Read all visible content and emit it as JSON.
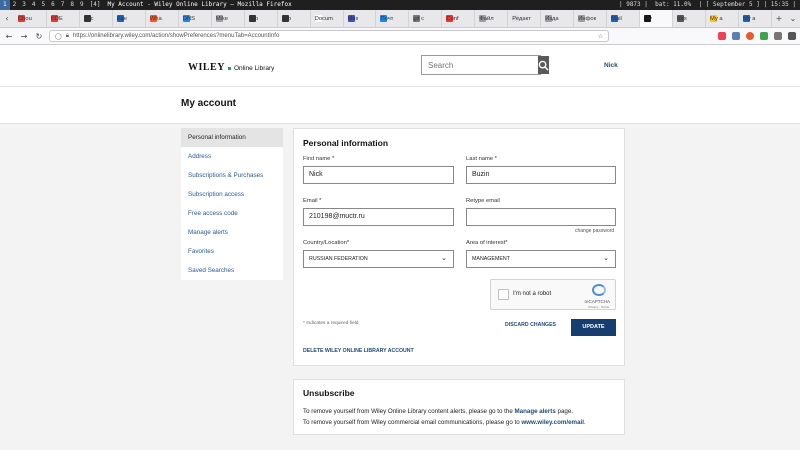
{
  "wm": {
    "workspaces": [
      "1",
      "2",
      "3",
      "4",
      "5",
      "6",
      "7",
      "8",
      "9",
      "[4]"
    ],
    "title": "My Account - Wiley Online Library — Mozilla Firefox",
    "status": "| 9873 |  bat: 11.0%  | [ September 5 ] | 15:35 |"
  },
  "tabs": [
    {
      "label": "Chou",
      "color": "#e53935"
    },
    {
      "label": "KDE",
      "color": "#e53935"
    },
    {
      "label": "Acc",
      "color": "#333333"
    },
    {
      "label": "Кан",
      "color": "#1565c0"
    },
    {
      "label": "Wha",
      "color": "#ff5722"
    },
    {
      "label": "DNS",
      "color": "#1e88e5"
    },
    {
      "label": "Mike",
      "color": "#9e9e9e"
    },
    {
      "label": "cpp",
      "color": "#333333"
    },
    {
      "label": "cpp",
      "color": "#333333"
    },
    {
      "label": "Docum",
      "color": "#ffffff"
    },
    {
      "label": "Mes",
      "color": "#3f51b5"
    },
    {
      "label": "Почт",
      "color": "#1e88e5"
    },
    {
      "label": "git c",
      "color": "#777777"
    },
    {
      "label": "Conf",
      "color": "#e53935"
    },
    {
      "label": "Файл",
      "color": "#9e9e9e"
    },
    {
      "label": "Редакт",
      "color": "#e0e0e0"
    },
    {
      "label": "Изда",
      "color": "#9e9e9e"
    },
    {
      "label": "Инфок",
      "color": "#9e9e9e"
    },
    {
      "label": "Mail",
      "color": "#1565c0"
    },
    {
      "label": "My",
      "color": "#111111"
    },
    {
      "label": "tors",
      "color": "#555555"
    },
    {
      "label": "My a",
      "color": "#fbc02d"
    },
    {
      "label": "My a",
      "color": "#1565c0"
    }
  ],
  "nav": {
    "url": "https://onlinelibrary.wiley.com/action/showPreferences?menuTab=AccountInfo"
  },
  "site": {
    "logo_main": "WILEY",
    "logo_sub": "Online Library",
    "search_placeholder": "Search",
    "user": "Nick"
  },
  "page_title": "My account",
  "sidenav": [
    "Personal information",
    "Address",
    "Subscriptions & Purchases",
    "Subscription access",
    "Free access code",
    "Manage alerts",
    "Favorites",
    "Saved Searches"
  ],
  "form": {
    "heading": "Personal information",
    "first_name_label": "First name *",
    "first_name_value": "Nick",
    "last_name_label": "Last name *",
    "last_name_value": "Buzin",
    "email_label": "Email *",
    "email_value": "210198@muctr.ru",
    "retype_label": "Retype email",
    "retype_value": "",
    "change_password": "change password",
    "country_label": "Country/Location*",
    "country_value": "RUSSIAN FEDERATION",
    "interest_label": "Area of interest*",
    "interest_value": "MANAGEMENT",
    "captcha_text": "I'm not a robot",
    "captcha_brand": "reCAPTCHA",
    "captcha_links": "Privacy - Terms",
    "required_note": "* Indicates a required field",
    "discard": "DISCARD CHANGES",
    "update": "UPDATE",
    "delete": "DELETE WILEY ONLINE LIBRARY ACCOUNT"
  },
  "unsub": {
    "heading": "Unsubscribe",
    "line1_pre": "To remove yourself from Wiley Online Library content alerts, please go to the ",
    "line1_link": "Manage alerts",
    "line1_post": " page.",
    "line2_pre": "To remove yourself from Wiley commercial email communications, please go to ",
    "line2_link": "www.wiley.com/email",
    "line2_post": "."
  }
}
